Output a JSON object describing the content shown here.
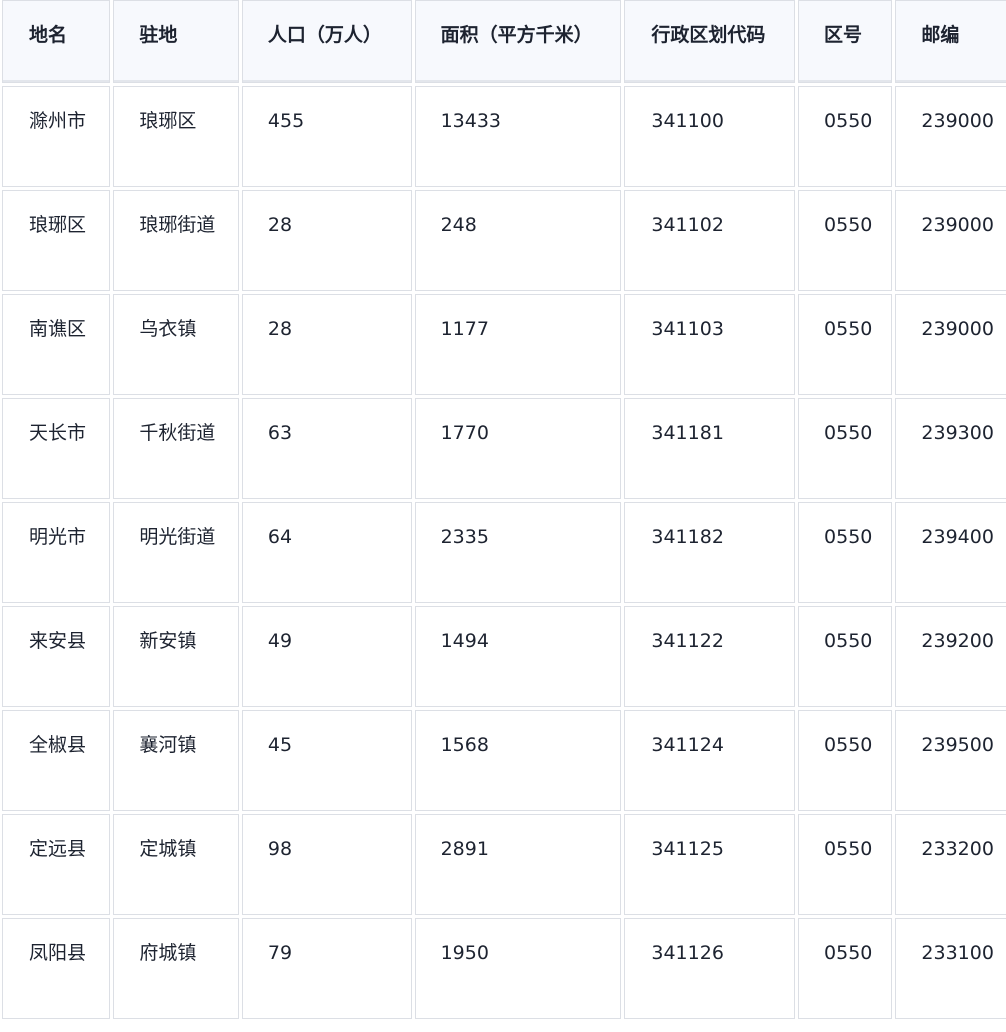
{
  "table": {
    "headers": {
      "name": "地名",
      "seat": "驻地",
      "population": "人口（万人）",
      "area": "面积（平方千米）",
      "code": "行政区划代码",
      "tel": "区号",
      "postcode": "邮编"
    },
    "rows": [
      {
        "name": "滁州市",
        "seat": "琅琊区",
        "population": "455",
        "area": "13433",
        "code": "341100",
        "tel": "0550",
        "postcode": "239000"
      },
      {
        "name": "琅琊区",
        "seat": "琅琊街道",
        "population": "28",
        "area": "248",
        "code": "341102",
        "tel": "0550",
        "postcode": "239000"
      },
      {
        "name": "南谯区",
        "seat": "乌衣镇",
        "population": "28",
        "area": "1177",
        "code": "341103",
        "tel": "0550",
        "postcode": "239000"
      },
      {
        "name": "天长市",
        "seat": "千秋街道",
        "population": "63",
        "area": "1770",
        "code": "341181",
        "tel": "0550",
        "postcode": "239300"
      },
      {
        "name": "明光市",
        "seat": "明光街道",
        "population": "64",
        "area": "2335",
        "code": "341182",
        "tel": "0550",
        "postcode": "239400"
      },
      {
        "name": "来安县",
        "seat": "新安镇",
        "population": "49",
        "area": "1494",
        "code": "341122",
        "tel": "0550",
        "postcode": "239200"
      },
      {
        "name": "全椒县",
        "seat": "襄河镇",
        "population": "45",
        "area": "1568",
        "code": "341124",
        "tel": "0550",
        "postcode": "239500"
      },
      {
        "name": "定远县",
        "seat": "定城镇",
        "population": "98",
        "area": "2891",
        "code": "341125",
        "tel": "0550",
        "postcode": "233200"
      },
      {
        "name": "凤阳县",
        "seat": "府城镇",
        "population": "79",
        "area": "1950",
        "code": "341126",
        "tel": "0550",
        "postcode": "233100"
      }
    ]
  }
}
